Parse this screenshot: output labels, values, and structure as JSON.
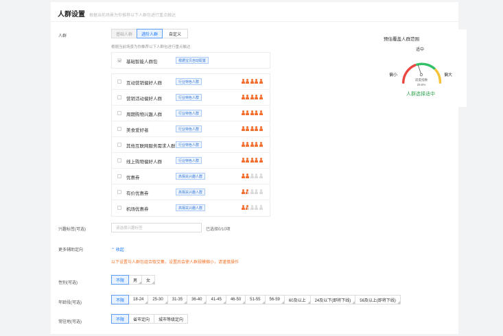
{
  "header": {
    "title": "人群设置",
    "subtitle": "根据当前场景为你推荐以下人群包进行重点触达"
  },
  "crowd": {
    "label": "人群",
    "modes": [
      {
        "label": "基础人群",
        "state": "disabled"
      },
      {
        "label": "进阶人群",
        "state": "selected"
      },
      {
        "label": "自定义",
        "state": "normal"
      }
    ],
    "hint": "根据当前场景为你推荐以下人群包进行重点触达",
    "base_pack": {
      "name": "基础智能人群包",
      "tag": "根据宝贝自动配置",
      "checked": true
    },
    "items": [
      {
        "name": "互动营销偏好人群",
        "tag": "行业特色人群",
        "rating": 5
      },
      {
        "name": "营销活动偏好人群",
        "tag": "行业特色人群",
        "rating": 5
      },
      {
        "name": "周期购物兴趣人群",
        "tag": "行业特色人群",
        "rating": 5
      },
      {
        "name": "美食爱好者",
        "tag": "行业特色人群",
        "rating": 5
      },
      {
        "name": "其他互联网服务需求人群",
        "tag": "行业特色人群",
        "rating": 5
      },
      {
        "name": "线上购物偏好人群",
        "tag": "行业特色人群",
        "rating": 5
      },
      {
        "name": "优惠券",
        "tag": "高相关兴趣人群",
        "rating": 2
      },
      {
        "name": "有价优惠券",
        "tag": "高相关兴趣人群",
        "rating": 1.5
      },
      {
        "name": "机场优惠券",
        "tag": "高相关兴趣人群",
        "rating": 1.5
      }
    ]
  },
  "gauge": {
    "title": "预估覆盖人群范围",
    "label_left": "偏小",
    "label_top": "适中",
    "label_right": "偏大",
    "metric_name": "适度指数",
    "metric_value": "29.6%",
    "result": "人群选择适中",
    "needle_fraction": 0.296
  },
  "interest": {
    "label": "兴趣标签(可选)",
    "placeholder": "请选择兴趣标签",
    "count": "已选择0/10项"
  },
  "more": {
    "label": "更多辅助定向",
    "toggle": "收起",
    "warning": "以下设置与人群包组合取交集，设置后会使人群规模缩小，请谨慎操作"
  },
  "gender": {
    "label": "性别(可选)",
    "options": [
      "不限",
      "男",
      "女"
    ],
    "selected": 0
  },
  "age": {
    "label": "年龄段(可选)",
    "options": [
      "不限",
      "18-24",
      "25-30",
      "31-35",
      "36-40",
      "41-45",
      "46-50",
      "51-55",
      "56-59",
      "60及以上",
      "24及以下(即将下线)",
      "56及以上(即将下线)"
    ],
    "selected": 0
  },
  "residence": {
    "label": "常驻地(可选)",
    "options": [
      "不限",
      "省市定向",
      "城市等级定向"
    ],
    "selected": 0
  },
  "colors": {
    "primary": "#1677ff",
    "warning": "#f3752b",
    "success": "#2ea44f",
    "rating": "#f36d2e"
  }
}
